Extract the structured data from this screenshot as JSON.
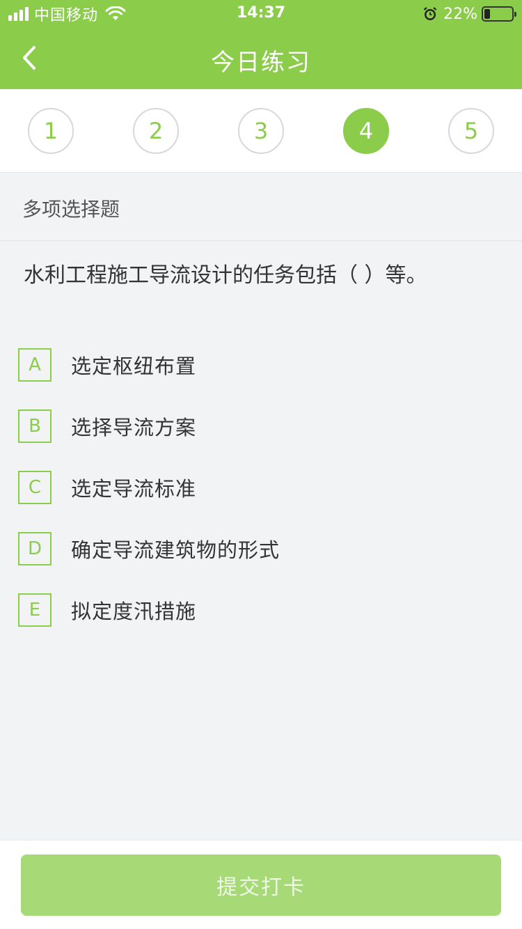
{
  "status_bar": {
    "carrier": "中国移动",
    "time": "14:37",
    "battery_pct": "22%",
    "battery_level": 0.22,
    "icons": [
      "signal-icon",
      "wifi-icon",
      "alarm-icon",
      "battery-icon"
    ]
  },
  "nav": {
    "title": "今日练习",
    "back_icon": "chevron-left-icon"
  },
  "questions": {
    "numbers": [
      "1",
      "2",
      "3",
      "4",
      "5"
    ],
    "active_index": 3
  },
  "question": {
    "type": "多项选择题",
    "text": "水利工程施工导流设计的任务包括（    ）等。",
    "options": [
      {
        "letter": "A",
        "text": "选定枢纽布置"
      },
      {
        "letter": "B",
        "text": "选择导流方案"
      },
      {
        "letter": "C",
        "text": "选定导流标准"
      },
      {
        "letter": "D",
        "text": "确定导流建筑物的形式"
      },
      {
        "letter": "E",
        "text": "拟定度汛措施"
      }
    ]
  },
  "footer": {
    "submit_label": "提交打卡"
  },
  "colors": {
    "accent": "#8bcc4a",
    "submit_bg": "#a7da76",
    "page_bg": "#f2f3f5"
  }
}
